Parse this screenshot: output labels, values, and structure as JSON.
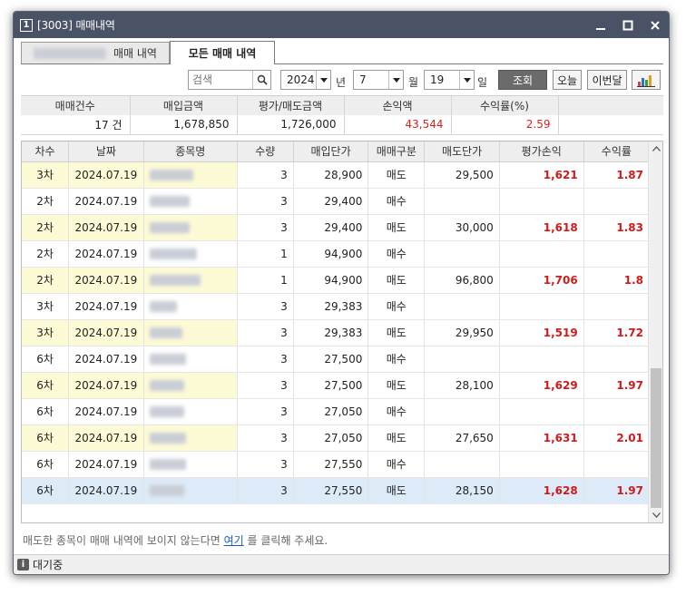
{
  "window": {
    "number": "1",
    "title": "[3003] 매매내역"
  },
  "tabs": [
    {
      "label": "매매 내역"
    },
    {
      "label": "모든 매매 내역"
    }
  ],
  "toolbar": {
    "search_placeholder": "검색",
    "year": "2024",
    "year_unit": "년",
    "month": "7",
    "month_unit": "월",
    "day": "19",
    "day_unit": "일",
    "query_label": "조회",
    "today_label": "오늘",
    "this_month_label": "이번달"
  },
  "summary": {
    "headers": [
      "매매건수",
      "매입금액",
      "평가/매도금액",
      "손익액",
      "수익률(%)"
    ],
    "values": [
      "17 건",
      "1,678,850",
      "1,726,000",
      "43,544",
      "2.59"
    ]
  },
  "grid": {
    "headers": [
      "차수",
      "날짜",
      "종목명",
      "수량",
      "매입단가",
      "매매구분",
      "매도단가",
      "평가손익",
      "수익률"
    ],
    "rows": [
      {
        "round": "3차",
        "date": "2024.07.19",
        "qty": "3",
        "buy_price": "28,900",
        "type": "매도",
        "sell_price": "29,500",
        "pnl": "1,621",
        "rate": "1.87"
      },
      {
        "round": "2차",
        "date": "2024.07.19",
        "qty": "3",
        "buy_price": "29,400",
        "type": "매수",
        "sell_price": "",
        "pnl": "",
        "rate": ""
      },
      {
        "round": "2차",
        "date": "2024.07.19",
        "qty": "3",
        "buy_price": "29,400",
        "type": "매도",
        "sell_price": "30,000",
        "pnl": "1,618",
        "rate": "1.83"
      },
      {
        "round": "2차",
        "date": "2024.07.19",
        "qty": "1",
        "buy_price": "94,900",
        "type": "매수",
        "sell_price": "",
        "pnl": "",
        "rate": ""
      },
      {
        "round": "2차",
        "date": "2024.07.19",
        "qty": "1",
        "buy_price": "94,900",
        "type": "매도",
        "sell_price": "96,800",
        "pnl": "1,706",
        "rate": "1.8"
      },
      {
        "round": "3차",
        "date": "2024.07.19",
        "qty": "3",
        "buy_price": "29,383",
        "type": "매수",
        "sell_price": "",
        "pnl": "",
        "rate": ""
      },
      {
        "round": "3차",
        "date": "2024.07.19",
        "qty": "3",
        "buy_price": "29,383",
        "type": "매도",
        "sell_price": "29,950",
        "pnl": "1,519",
        "rate": "1.72"
      },
      {
        "round": "6차",
        "date": "2024.07.19",
        "qty": "3",
        "buy_price": "27,500",
        "type": "매수",
        "sell_price": "",
        "pnl": "",
        "rate": ""
      },
      {
        "round": "6차",
        "date": "2024.07.19",
        "qty": "3",
        "buy_price": "27,500",
        "type": "매도",
        "sell_price": "28,100",
        "pnl": "1,629",
        "rate": "1.97"
      },
      {
        "round": "6차",
        "date": "2024.07.19",
        "qty": "3",
        "buy_price": "27,050",
        "type": "매수",
        "sell_price": "",
        "pnl": "",
        "rate": ""
      },
      {
        "round": "6차",
        "date": "2024.07.19",
        "qty": "3",
        "buy_price": "27,050",
        "type": "매도",
        "sell_price": "27,650",
        "pnl": "1,631",
        "rate": "2.01"
      },
      {
        "round": "6차",
        "date": "2024.07.19",
        "qty": "3",
        "buy_price": "27,550",
        "type": "매수",
        "sell_price": "",
        "pnl": "",
        "rate": ""
      },
      {
        "round": "6차",
        "date": "2024.07.19",
        "qty": "3",
        "buy_price": "27,550",
        "type": "매도",
        "sell_price": "28,150",
        "pnl": "1,628",
        "rate": "1.97"
      }
    ]
  },
  "hint": {
    "before": "매도한 종목이 매매 내역에 보이지 않는다면 ",
    "link": "여기",
    "after": " 를 클릭해 주세요."
  },
  "status": {
    "icon": "i",
    "text": "대기중"
  },
  "colors": {
    "titlebar": "#4a5266",
    "profit_red": "#d21a1a",
    "row_highlight": "#fdfbd6",
    "selected_row": "#dcebf7",
    "link_blue": "#1a5fbf"
  }
}
